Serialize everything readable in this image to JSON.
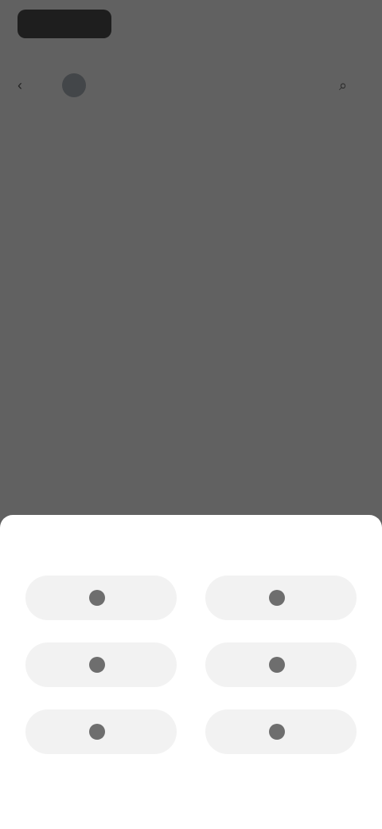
{
  "status_bar": {
    "left_text": "",
    "right_text": ""
  },
  "header": {
    "account_name": "",
    "action_label": ""
  },
  "page": {
    "subtitle": ""
  },
  "sheet": {
    "title": "",
    "options": [
      {
        "label": "",
        "icon": "circle-icon"
      },
      {
        "label": "",
        "icon": "circle-icon"
      },
      {
        "label": "",
        "icon": "circle-icon"
      },
      {
        "label": "",
        "icon": "circle-icon"
      },
      {
        "label": "",
        "icon": "circle-icon"
      },
      {
        "label": "",
        "icon": "circle-icon"
      }
    ]
  },
  "colors": {
    "scrim": "#1e1e1e",
    "sheet_bg": "#ffffff",
    "option_bg": "#f2f2f2"
  }
}
